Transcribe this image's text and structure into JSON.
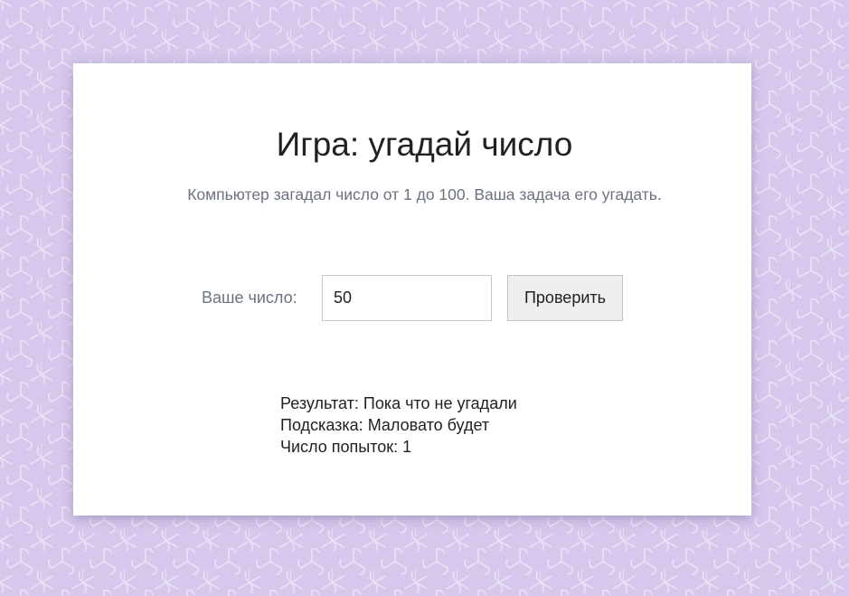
{
  "game": {
    "title": "Игра: угадай число",
    "subtitle": "Компьютер загадал число от 1 до 100. Ваша задача его угадать."
  },
  "form": {
    "label": "Ваше число:",
    "input_value": "50",
    "button_label": "Проверить"
  },
  "results": {
    "result_label": "Результат:",
    "result_value": "Пока что не угадали",
    "hint_label": "Подсказка:",
    "hint_value": "Маловато будет",
    "attempts_label": "Число попыток:",
    "attempts_value": "1"
  },
  "colors": {
    "background": "#d6c8ec",
    "card": "#ffffff",
    "muted_text": "#6b7280",
    "text": "#212121",
    "button_bg": "#efefef"
  }
}
